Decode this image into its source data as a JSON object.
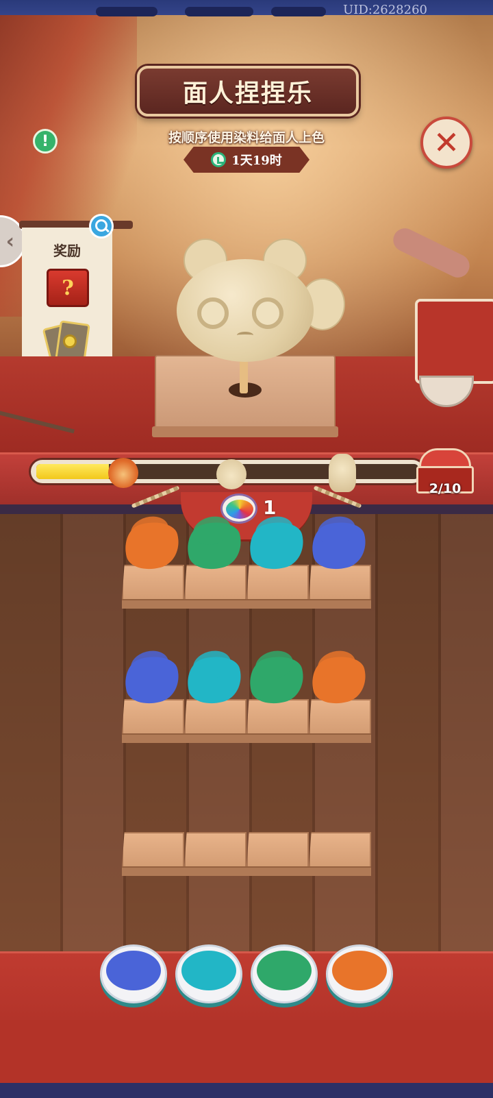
{
  "header": {
    "uid": "UID:2628260"
  },
  "event": {
    "title": "面人捏捏乐",
    "subtitle": "按顺序使用染料给面人上色",
    "timer": "1天19时"
  },
  "icons": {
    "info": "exclamation-icon",
    "close": "close-icon",
    "search": "magnifier-icon",
    "back": "chevron-left-icon",
    "clock": "clock-icon",
    "rainbow_dye": "rainbow-dye-icon"
  },
  "rewards": {
    "title": "奖励",
    "mystery_box_glyph": "?",
    "items": [
      "mystery-box-icon",
      "card-pack-icon"
    ]
  },
  "progress": {
    "fraction": 0.19,
    "milestones": [
      "dragon-figure-icon",
      "cat-figure-icon",
      "girl-figure-icon"
    ],
    "chest_count": "2/10"
  },
  "rainbow_dye": {
    "count": "1"
  },
  "colors": {
    "orange": "#e8742a",
    "green": "#2fa86a",
    "teal": "#22b6c6",
    "blue": "#4a64d8"
  },
  "shelves": [
    {
      "slots": [
        "orange",
        "green",
        "teal",
        "blue"
      ]
    },
    {
      "slots": [
        "blue",
        "teal",
        "green",
        "orange"
      ]
    },
    {
      "slots": [
        "",
        "",
        "",
        ""
      ]
    }
  ],
  "dye_bowls": [
    "blue",
    "teal",
    "green",
    "orange"
  ]
}
